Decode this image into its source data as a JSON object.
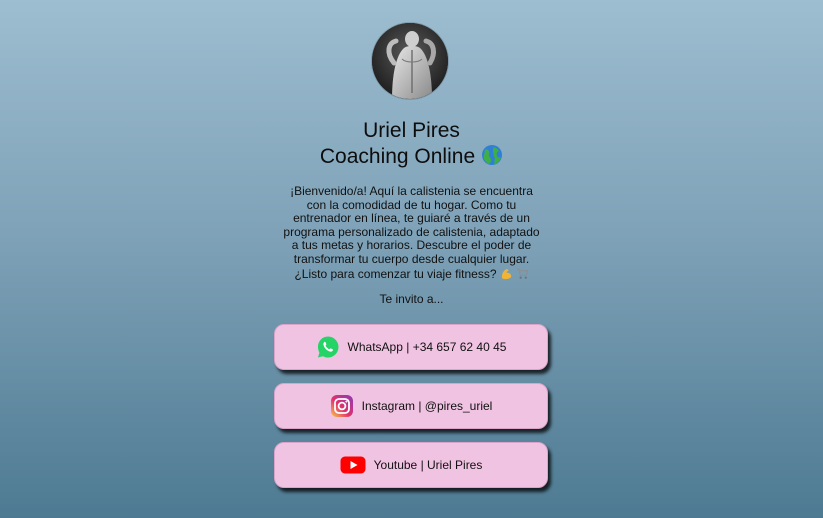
{
  "profile": {
    "name": "Uriel Pires",
    "subtitle": "Coaching Online",
    "subtitle_icon": "globe-icon",
    "bio": "¡Bienvenido/a! Aquí la calistenia se encuentra con la comodidad de tu hogar. Como tu entrenador en línea, te guiaré a través de un programa personalizado de calistenia, adaptado a tus metas y horarios. Descubre el poder de transformar tu cuerpo desde cualquier lugar. ¿Listo para comenzar tu viaje fitness?",
    "bio_icons": [
      "flexed-biceps-icon",
      "shopping-cart-icon"
    ],
    "invite": "Te invito a..."
  },
  "links": [
    {
      "label": "WhatsApp | +34 657 62 40 45",
      "icon": "whatsapp-icon",
      "color": "#25d366"
    },
    {
      "label": "Instagram | @pires_uriel",
      "icon": "instagram-icon",
      "color": "#e1306c"
    },
    {
      "label": "Youtube | Uriel Pires",
      "icon": "youtube-icon",
      "color": "#ff0000"
    }
  ],
  "colors": {
    "background_top": "#9dbdd0",
    "background_bottom": "#4d7a92",
    "button_fill": "#f1c3e2"
  }
}
